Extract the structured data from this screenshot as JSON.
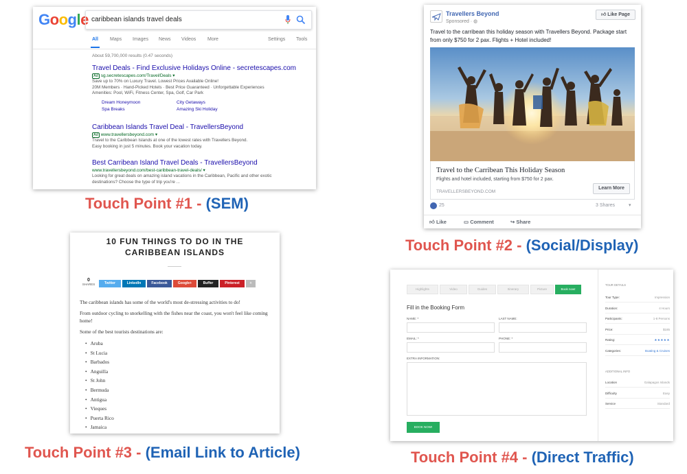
{
  "captions": {
    "tp1": {
      "prefix": "Touch Point #1 - ",
      "label": "(SEM)"
    },
    "tp2": {
      "prefix": "Touch Point #2 - ",
      "label": "(Social/Display)"
    },
    "tp3": {
      "prefix": "Touch Point #3 - ",
      "label": "(Email Link to Article)"
    },
    "tp4": {
      "prefix": "Touch Point #4 - ",
      "label": "(Direct Traffic)"
    }
  },
  "google": {
    "logo": "Google",
    "query": "caribbean islands travel deals",
    "tabs": [
      "All",
      "Maps",
      "Images",
      "News",
      "Videos",
      "More",
      "Settings",
      "Tools"
    ],
    "stats": "About 59,700,000 results (0.47 seconds)",
    "results": [
      {
        "title": "Travel Deals - Find Exclusive Holidays Online - secretescapes.com",
        "ad": "Ad",
        "url": "sg.secretescapes.com/Travel/Deals ▾",
        "desc": [
          "Save up to 70% on Luxury Travel. Lowest Prices Available Online!",
          "20M Members · Hand-Picked Hotels · Best Price Guaranteed · Unforgettable Experiences",
          "Amenities: Pool, WiFi, Fitness Center, Spa, Golf, Car Park"
        ],
        "sitelinks": [
          "Dream Honeymoon",
          "City Getaways",
          "Spa Breaks",
          "Amazing Ski Holiday"
        ]
      },
      {
        "title": "Caribbean Islands Travel Deal - TravellersBeyond",
        "ad": "Ad",
        "url": "www.travellersbeyond.com ▾",
        "desc": [
          "Travel to the Caribbean Islands at one of the lowest rates with Travellers Beyond.",
          "Easy booking in just 5 minutes. Book your vacation today."
        ]
      },
      {
        "title": "Best Carribean Island Travel Deals - TravellersBeyond",
        "url": "www.travellersbeyond.com/best-caribbean-travel-deals/ ▾",
        "desc": [
          "Looking for great deals on amazing island vacations in the Caribbean, Pacific and other exotic",
          "destinations? Choose the type of trip you're ..."
        ]
      }
    ],
    "colors": {
      "blue": "#4285F4",
      "red": "#EA4335",
      "yellow": "#FBBC05",
      "green": "#34A853"
    }
  },
  "facebook": {
    "page_name": "Travellers Beyond",
    "sponsored": "Sponsored · ",
    "like_page": "Like Page",
    "post_text": "Travel to the carribean this holiday season with Travellers Beyond. Package start from only $750 for 2 pax. Flights + Hotel included!",
    "headline": "Travel to the Carribean This Holiday Season",
    "subline": "Flights and hotel included, starting from $750 for 2 pax.",
    "domain": "TRAVELLERSBEYOND.COM",
    "cta": "Learn More",
    "likes": "25",
    "shares": "3 Shares",
    "actions": {
      "like": "Like",
      "comment": "Comment",
      "share": "Share"
    }
  },
  "article": {
    "title_line1": "10 FUN THINGS TO DO IN THE",
    "title_line2": "CARIBBEAN ISLANDS",
    "share_count": "0",
    "share_label": "SHARES",
    "share_buttons": [
      {
        "label": "Twitter",
        "color": "#55acee"
      },
      {
        "label": "LinkedIn",
        "color": "#0077b5"
      },
      {
        "label": "Facebook",
        "color": "#3b5998"
      },
      {
        "label": "Google+",
        "color": "#dd4b39"
      },
      {
        "label": "Buffer",
        "color": "#222222"
      },
      {
        "label": "Pinterest",
        "color": "#cb2027"
      },
      {
        "label": "+",
        "color": "#bbbbbb"
      }
    ],
    "para1": "The caribbean islands has some of the world's most de-stressing activities to do!",
    "para2": "From outdoor cycling to snorkelling with the fishes near the coast, you won't feel like coming home!",
    "para3": "Some of the best tourists destinations are:",
    "destinations": [
      "Aruba",
      "St Lucia",
      "Barbados",
      "Anguilla",
      "St John",
      "Bermuda",
      "Antigua",
      "Vieques",
      "Puerta Rico",
      "Jamaica"
    ]
  },
  "booking": {
    "tabs": [
      "Highlights",
      "Video",
      "Guides",
      "Itinerary",
      "Picture",
      "Book now!"
    ],
    "heading": "Fill in the Booking Form",
    "labels": {
      "name": "NAME: *",
      "last_name": "LAST NAME:",
      "email": "EMAIL: *",
      "phone": "PHONE: *",
      "extra": "EXTRA INFORMATION:"
    },
    "submit": "BOOK NOW!",
    "details_heading": "TOUR DETAILS",
    "details": [
      {
        "k": "Tour Type:",
        "v": "Impression"
      },
      {
        "k": "Duration:",
        "v": "4 Hours"
      },
      {
        "k": "Participants:",
        "v": "1-8 Persons"
      },
      {
        "k": "Price:",
        "v": "$185"
      },
      {
        "k": "Rating:",
        "v": "★★★★★"
      },
      {
        "k": "Categories:",
        "v": "Boating & Cruises"
      }
    ],
    "additional_heading": "ADDITIONAL INFO",
    "additional": [
      {
        "k": "Location",
        "v": "Galapagos Islands"
      },
      {
        "k": "Difficulty",
        "v": "Easy"
      },
      {
        "k": "Service",
        "v": "Standard"
      }
    ],
    "accent": "#27ae60"
  }
}
